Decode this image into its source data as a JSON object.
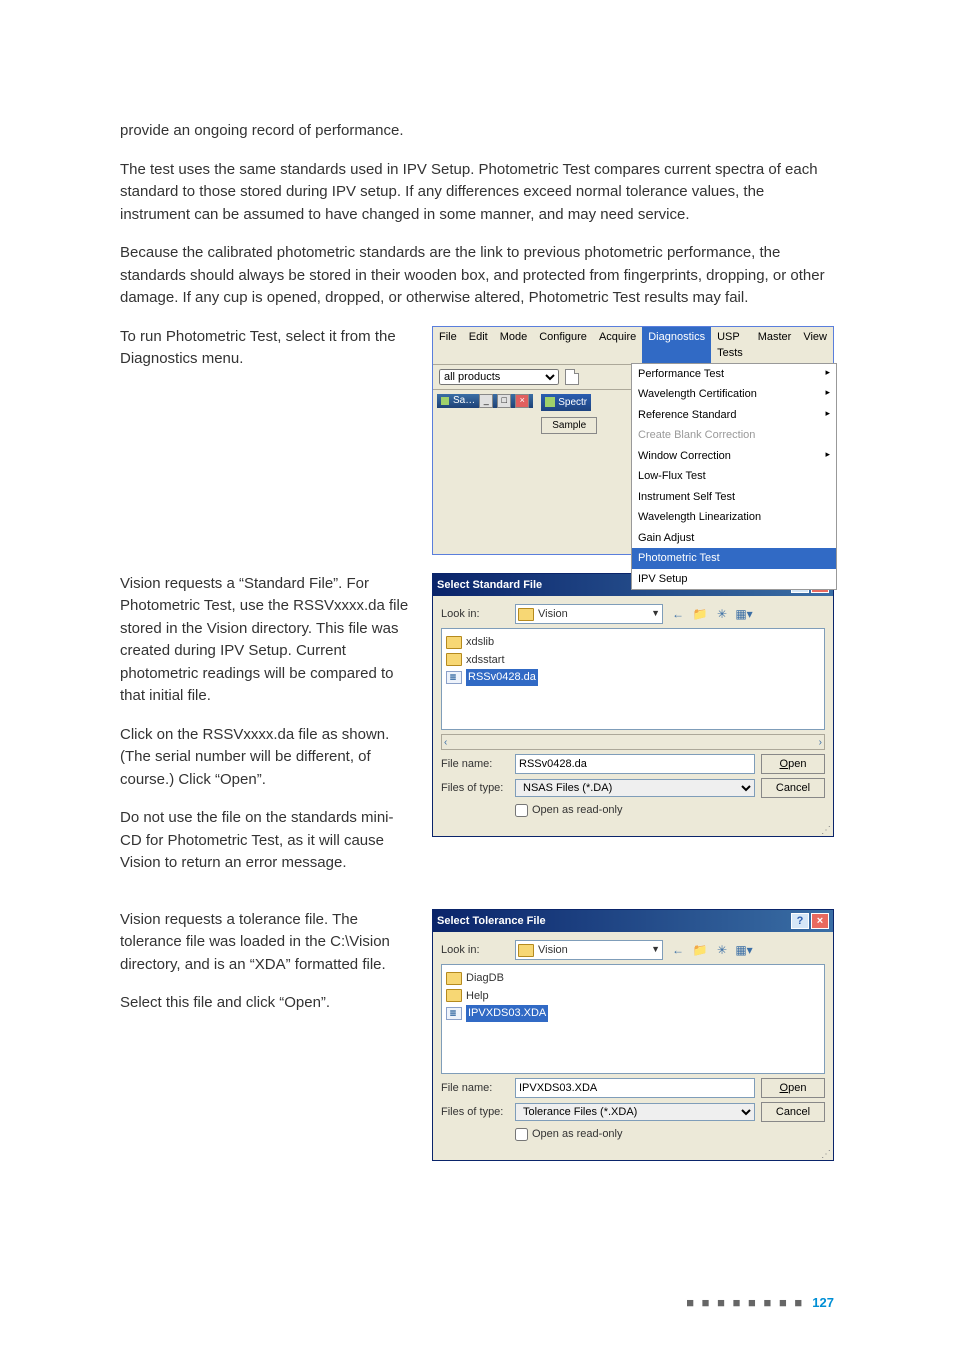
{
  "paragraphs": {
    "p1": "provide an ongoing record of performance.",
    "p2": "The test uses the same standards used in IPV Setup. Photometric Test compares current spectra of each standard to those stored during IPV setup. If any differences exceed normal tolerance values, the instrument can be assumed to have changed in some manner, and may need service.",
    "p3": "Because the calibrated photometric standards are the link to previous photometric performance, the standards should always be stored in their wooden box, and protected from fingerprints, dropping, or other damage. If any cup is opened, dropped, or otherwise altered, Photometric Test results may fail.",
    "p4": "To run Photometric Test, select it from the Diagnostics menu.",
    "p5": "Vision requests a “Standard File”. For Photometric Test, use the RSSVxxxx.da file stored in the Vision directory. This file was created during IPV Setup. Current photometric readings will be compared to that initial file.",
    "p6": "Click on the RSSVxxxx.da file as shown. (The serial number will be different, of course.) Click “Open”.",
    "p7": "Do not use the file on the standards mini-CD for Photometric Test, as it will cause Vision to return an error message.",
    "p8": "Vision requests a tolerance file. The tolerance file was loaded in the C:\\Vision directory, and is an “XDA” formatted file.",
    "p9": "Select this file and click “Open”."
  },
  "menubar": {
    "items": [
      "File",
      "Edit",
      "Mode",
      "Configure",
      "Acquire",
      "Diagnostics",
      "USP Tests",
      "Master",
      "View"
    ],
    "active": "Diagnostics",
    "select": "all products",
    "sa_tab": "Sa…",
    "spectr": "Spectr",
    "sample": "Sample",
    "dropdown": [
      {
        "label": "Performance Test",
        "sub": true
      },
      {
        "label": "Wavelength Certification",
        "sub": true
      },
      {
        "label": "Reference Standard",
        "sub": true
      },
      {
        "label": "Create Blank Correction",
        "disabled": true
      },
      {
        "label": "Window Correction",
        "sub": true
      },
      {
        "label": "Low-Flux Test"
      },
      {
        "label": "Instrument Self Test"
      },
      {
        "label": "Wavelength Linearization"
      },
      {
        "label": "Gain Adjust"
      },
      {
        "label": "Photometric Test",
        "highlight": true
      },
      {
        "label": "IPV Setup"
      }
    ]
  },
  "dlg1": {
    "title": "Select Standard File",
    "lookin_label": "Look in:",
    "lookin_value": "Vision",
    "files": [
      {
        "name": "xdslib",
        "type": "folder"
      },
      {
        "name": "xdsstart",
        "type": "folder"
      },
      {
        "name": "RSSv0428.da",
        "type": "file",
        "selected": true
      }
    ],
    "filename_label": "File name:",
    "filename_value": "RSSv0428.da",
    "filetype_label": "Files of type:",
    "filetype_value": "NSAS Files (*.DA)",
    "open": "Open",
    "cancel": "Cancel",
    "readonly": "Open as read-only"
  },
  "dlg2": {
    "title": "Select Tolerance File",
    "lookin_label": "Look in:",
    "lookin_value": "Vision",
    "files": [
      {
        "name": "DiagDB",
        "type": "folder"
      },
      {
        "name": "Help",
        "type": "folder"
      },
      {
        "name": "IPVXDS03.XDA",
        "type": "file",
        "selected": true
      }
    ],
    "filename_label": "File name:",
    "filename_value": "IPVXDS03.XDA",
    "filetype_label": "Files of type:",
    "filetype_value": "Tolerance Files (*.XDA)",
    "open": "Open",
    "cancel": "Cancel",
    "readonly": "Open as read-only"
  },
  "page_number": "127"
}
